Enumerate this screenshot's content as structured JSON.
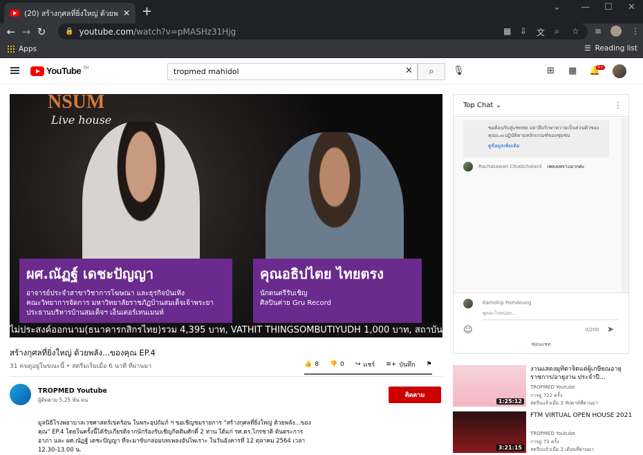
{
  "browser": {
    "tab_title": "(20) สร้างกุศลที่ยิ่งใหญ่ ด้วยพลั...",
    "url_host": "youtube.com",
    "url_path": "/watch?v=pMASHz31Hjg",
    "bookmark_apps": "Apps",
    "reading_list": "Reading list"
  },
  "youtube": {
    "logo_text": "YouTube",
    "logo_region": "TH",
    "search_query": "tropmed mahidol",
    "notification_count": "9+"
  },
  "video": {
    "overlay_big": "NSUM",
    "overlay_venue": "Live house",
    "card_left": {
      "name": "ผศ.ณัฏฐ์ เดชะปัญญา",
      "lines": [
        "อาจารย์ประจำสาขาวิชาการโฆษณา และธุรกิจบันเทิง",
        "คณะวิทยาการจัดการ มหาวิทยาลัยราชภัฏบ้านสมเด็จเจ้าพระยา",
        "ประธานบริหารบ้านสมเด็จฯ เอ็นเตอร์เทนเมนท์"
      ]
    },
    "card_right": {
      "name": "คุณอธิปไตย ไทยตรง",
      "lines": [
        "นักดนตรีรับเชิญ",
        "ศิลปินค่าย Gru Record"
      ]
    },
    "ticker": "ไม่ประสงค์ออกนาม(ธนาคารกสิกรไทย)รวม 4,395 บาท, VATHIT THINGSOMBUTIYUDH 1,000 บาท, สถาบันพัฒ",
    "title": "สร้างกุศลที่ยิ่งใหญ่ ด้วยพลัง...ของคุณ EP.4",
    "meta": "31 คนดูอยู่ในขณะนี้ • สตรีมเริ่มเมื่อ 6 นาที ที่ผ่านมา",
    "likes": "8",
    "dislikes": "0",
    "share": "แชร์",
    "save": "บันทึก"
  },
  "channel": {
    "name": "TROPMED Youtube",
    "subs": "ผู้ติดตาม 5.25 พัน คน",
    "subscribe": "ติดตาม",
    "description": "มูลนิธิโรงพยาบาลเวชศาสตร์เขตร้อน ในพระอุปถัมภ์ ฯ ขอเชิญชมรายการ \"สร้างกุศลที่ยิ่งใหญ่ ด้วยพลัง...ของคุณ\" EP.4 โดยในครั้งนี้ได้รับเกียรติจากนักร้องรับเชิญกิตติมศักดิ์ 2 ท่าน ได้แก่ รศ.ดร.ไกรชาติ ต้นตระการอาภา และ ผศ.ณัฏฐ์ เดชะปัญญา ที่จะมาขับกล่อมบทเพลงอันไพเราะ ในวันอังคารที่ 12 ตุลาคม 2564 เวลา 12.30-13.00 น."
  },
  "chat": {
    "header": "Top Chat",
    "notice": "ขอต้อนรับสู่แชทสด อย่าลืมรักษาความเป็นส่วนตัวของคุณและปฏิบัติตามหลักเกณฑ์ของชุมชน",
    "notice_link": "ดูข้อมูลเพิ่มเติม",
    "message_author": "Rachatawan Chiabchalard",
    "message_text": "เพลงเพราะมากค่ะ",
    "input_name": "Kamoltip Pomdoung",
    "input_placeholder": "พูดอะไรหน่อย...",
    "char_count": "0/200",
    "hide_chat": "ซ่อนแชท"
  },
  "recommendations": [
    {
      "title": "งานแสดงมุทิตาจิตแด่ผู้เกษียณอายุราชการ/อายุงาน ประจำปี...",
      "channel": "TROPMED Youtube",
      "views": "การดู 722 ครั้ง",
      "time": "สตรีมแล้วเมื่อ 3 สัปดาห์ที่ผ่านมา",
      "duration": "1:25:12"
    },
    {
      "title": "FTM VIRTUAL OPEN HOUSE 2021",
      "channel": "TROPMED Youtube",
      "views": "การดู 73 ครั้ง",
      "time": "สตรีมแล้วเมื่อ 3 เดือนที่ผ่านมา",
      "duration": "3:21:15"
    }
  ]
}
